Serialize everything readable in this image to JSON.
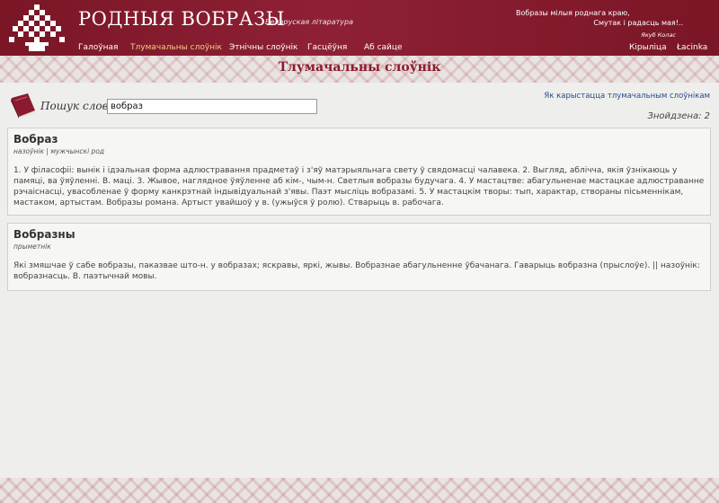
{
  "header": {
    "title": "РОДНЫЯ ВОБРАЗЫ",
    "subtitle": "Беларуская літаратура",
    "quote_line1": "Вобразы мілыя роднага краю,",
    "quote_line2": "Смутак і радасць мая!..",
    "quote_author": "Якуб Колас"
  },
  "nav": {
    "items": [
      "Галоўная",
      "Тлумачальны слоўнік",
      "Этнічны слоўнік",
      "Гасцёўня",
      "Аб сайце"
    ],
    "right_items": [
      "Кірыліца",
      "Łacinka"
    ],
    "active": "Тлумачальны слоўнік"
  },
  "page": {
    "title": "Тлумачальны слоўнік"
  },
  "search": {
    "label": "Пошук слова:",
    "value": "вобраз",
    "help_link": "Як карыстацца тлумачальным слоўнікам",
    "found": "Знойдзена: 2"
  },
  "entries": [
    {
      "word": "Вобраз",
      "pos": "назоўнік | мужчынскі род",
      "definition": "1. У філасофіі: вынік і ідэальная форма адлюстравання прадметаў і з'яў матэрыяльнага свету ў свядомасці чалавека. 2. Выгляд, аблічча, якія ўзнікаюць у памяці, ва ўяўленні. В. маці. 3. Жывое, наглядное ўяўленне аб кім-, чым-н. Светлыя вобразы будучага. 4. У мастацтве: абагульненае мастацкае адлюстраванне рэчаіснасці, увасобленае ў форму канкрэтнай індывідуальнай з'явы. Паэт мысліць вобразамі. 5. У мастацкім творы: тып, характар, створаны пісьменнікам, мастаком, артыстам. Вобразы романа. Артыст увайшоў у в. (ужыўся ў ролю). Стварыць в. рабочага."
    },
    {
      "word": "Вобразны",
      "pos": "прыметнік",
      "definition": "Які змяшчае ў сабе вобразы, паказвае што-н. у вобразах; яскравы, яркі, жывы. Вобразнае абагульненне ўбачанага. Гаварыць вобразна (прыслоўе). || назоўнік: вобразнасць. В. паэтычнай мовы."
    }
  ],
  "colors": {
    "header_bg": "#8e2035",
    "title_accent": "#8b1a2e",
    "link": "#2a4a8a",
    "nav_active": "#f0d080"
  }
}
